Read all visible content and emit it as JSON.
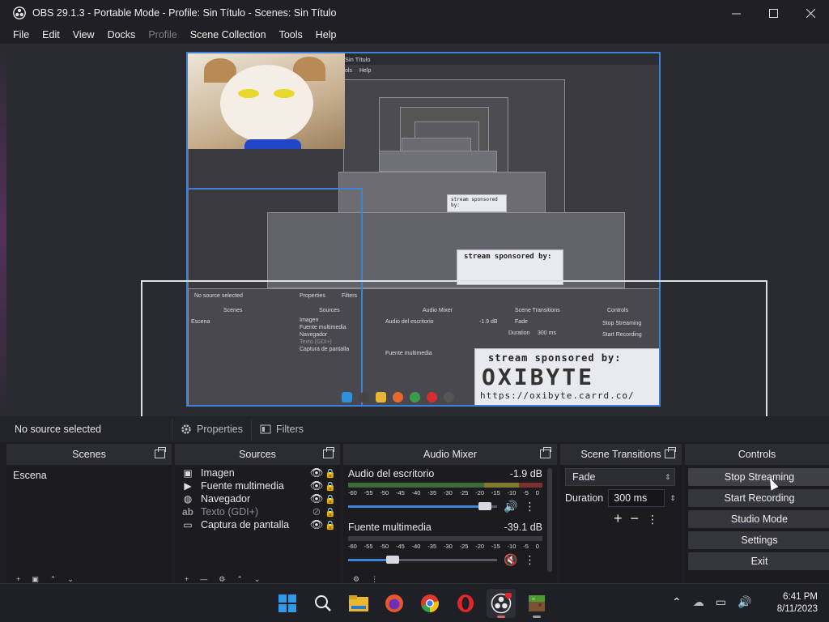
{
  "window": {
    "title": "OBS 29.1.3 - Portable Mode - Profile: Sin Título - Scenes: Sin Título"
  },
  "menu": {
    "items": [
      {
        "label": "File",
        "disabled": false
      },
      {
        "label": "Edit",
        "disabled": false
      },
      {
        "label": "View",
        "disabled": false
      },
      {
        "label": "Docks",
        "disabled": false
      },
      {
        "label": "Profile",
        "disabled": true
      },
      {
        "label": "Scene Collection",
        "disabled": false
      },
      {
        "label": "Tools",
        "disabled": false
      },
      {
        "label": "Help",
        "disabled": false
      }
    ]
  },
  "preview": {
    "nested_title": "Sin Título",
    "nested_menu_tools": "ols",
    "nested_menu_help": "Help",
    "sponsor_title": "stream sponsored by:",
    "sponsor_logo": "OXIBYTE",
    "sponsor_url": "https://oxibyte.carrd.co/",
    "nested_no_source": "No source selected",
    "nested_properties": "Properties",
    "nested_filters": "Filters",
    "nested_scenes": "Scenes",
    "nested_sources": "Sources",
    "nested_mixer": "Audio Mixer",
    "nested_transitions": "Scene Transitions",
    "nested_controls": "Controls",
    "nested_scene": "Escena",
    "nested_sources_list": [
      "Imagen",
      "Fuente multimedia",
      "Navegador",
      "Texto (GDI+)",
      "Captura de pantalla"
    ],
    "nested_audio": "Audio del escritorio",
    "nested_audio_db": "-1.9 dB",
    "nested_media": "Fuente multimedia",
    "nested_fade": "Fade",
    "nested_duration": "Duration",
    "nested_duration_val": "300 ms",
    "nested_stop": "Stop Streaming",
    "nested_start": "Start Recording"
  },
  "context_bar": {
    "no_source": "No source selected",
    "properties": "Properties",
    "filters": "Filters"
  },
  "scenes": {
    "title": "Scenes",
    "items": [
      "Escena"
    ]
  },
  "sources": {
    "title": "Sources",
    "items": [
      {
        "icon": "image-icon",
        "name": "Imagen",
        "visible": true
      },
      {
        "icon": "play-icon",
        "name": "Fuente multimedia",
        "visible": true
      },
      {
        "icon": "globe-icon",
        "name": "Navegador",
        "visible": true
      },
      {
        "icon": "text-icon",
        "name": "Texto (GDI+)",
        "visible": false
      },
      {
        "icon": "monitor-icon",
        "name": "Captura de pantalla",
        "visible": true
      }
    ]
  },
  "mixer": {
    "title": "Audio Mixer",
    "ticks": [
      "-60",
      "-55",
      "-50",
      "-45",
      "-40",
      "-35",
      "-30",
      "-25",
      "-20",
      "-15",
      "-10",
      "-5",
      "0"
    ],
    "channels": [
      {
        "name": "Audio del escritorio",
        "db": "-1.9 dB",
        "volume": 0.92,
        "muted": false
      },
      {
        "name": "Fuente multimedia",
        "db": "-39.1 dB",
        "volume": 0.3,
        "muted": true
      }
    ]
  },
  "transitions": {
    "title": "Scene Transitions",
    "selected": "Fade",
    "duration_label": "Duration",
    "duration_value": "300 ms"
  },
  "controls": {
    "title": "Controls",
    "buttons": [
      "Stop Streaming",
      "Start Recording",
      "Studio Mode",
      "Settings",
      "Exit"
    ]
  },
  "taskbar": {
    "time": "6:41 PM",
    "date": "8/11/2023"
  },
  "colors": {
    "accent": "#3f83d8",
    "muted_red": "#c8322e"
  }
}
